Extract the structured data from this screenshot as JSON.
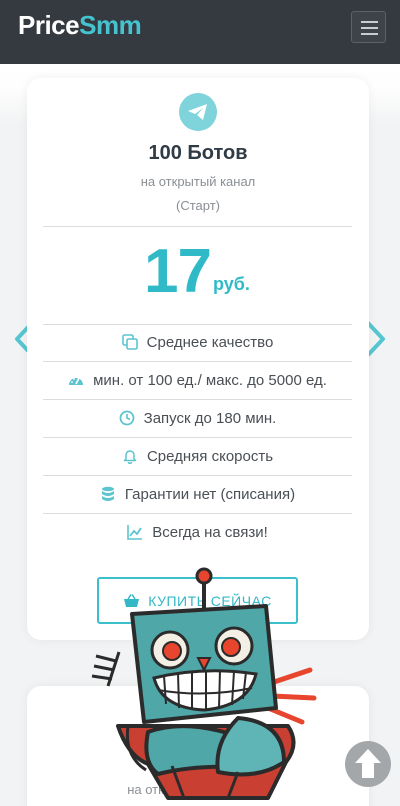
{
  "header": {
    "logo_part1": "Price",
    "logo_part2": "Smm"
  },
  "card": {
    "icon": "telegram-icon",
    "title": "100 Ботов",
    "subtitle": "на открытый канал",
    "tier": "(Старт)",
    "price": "17",
    "currency": "руб.",
    "features": [
      {
        "icon": "copy-icon",
        "text": "Среднее качество"
      },
      {
        "icon": "speedometer-icon",
        "text": "мин. от 100 ед./ макс. до 5000 ед."
      },
      {
        "icon": "clock-icon",
        "text": "Запуск до 180 мин."
      },
      {
        "icon": "bell-icon",
        "text": "Средняя скорость"
      },
      {
        "icon": "database-icon",
        "text": "Гарантии нет (списания)"
      },
      {
        "icon": "chart-line-icon",
        "text": "Всегда на связи!"
      }
    ],
    "buy_label": "КУПИТЬ СЕЙЧАС"
  },
  "card2": {
    "subtitle": "на открытый чат/группу"
  },
  "colors": {
    "accent": "#30bac8",
    "navbar": "#343a40"
  }
}
